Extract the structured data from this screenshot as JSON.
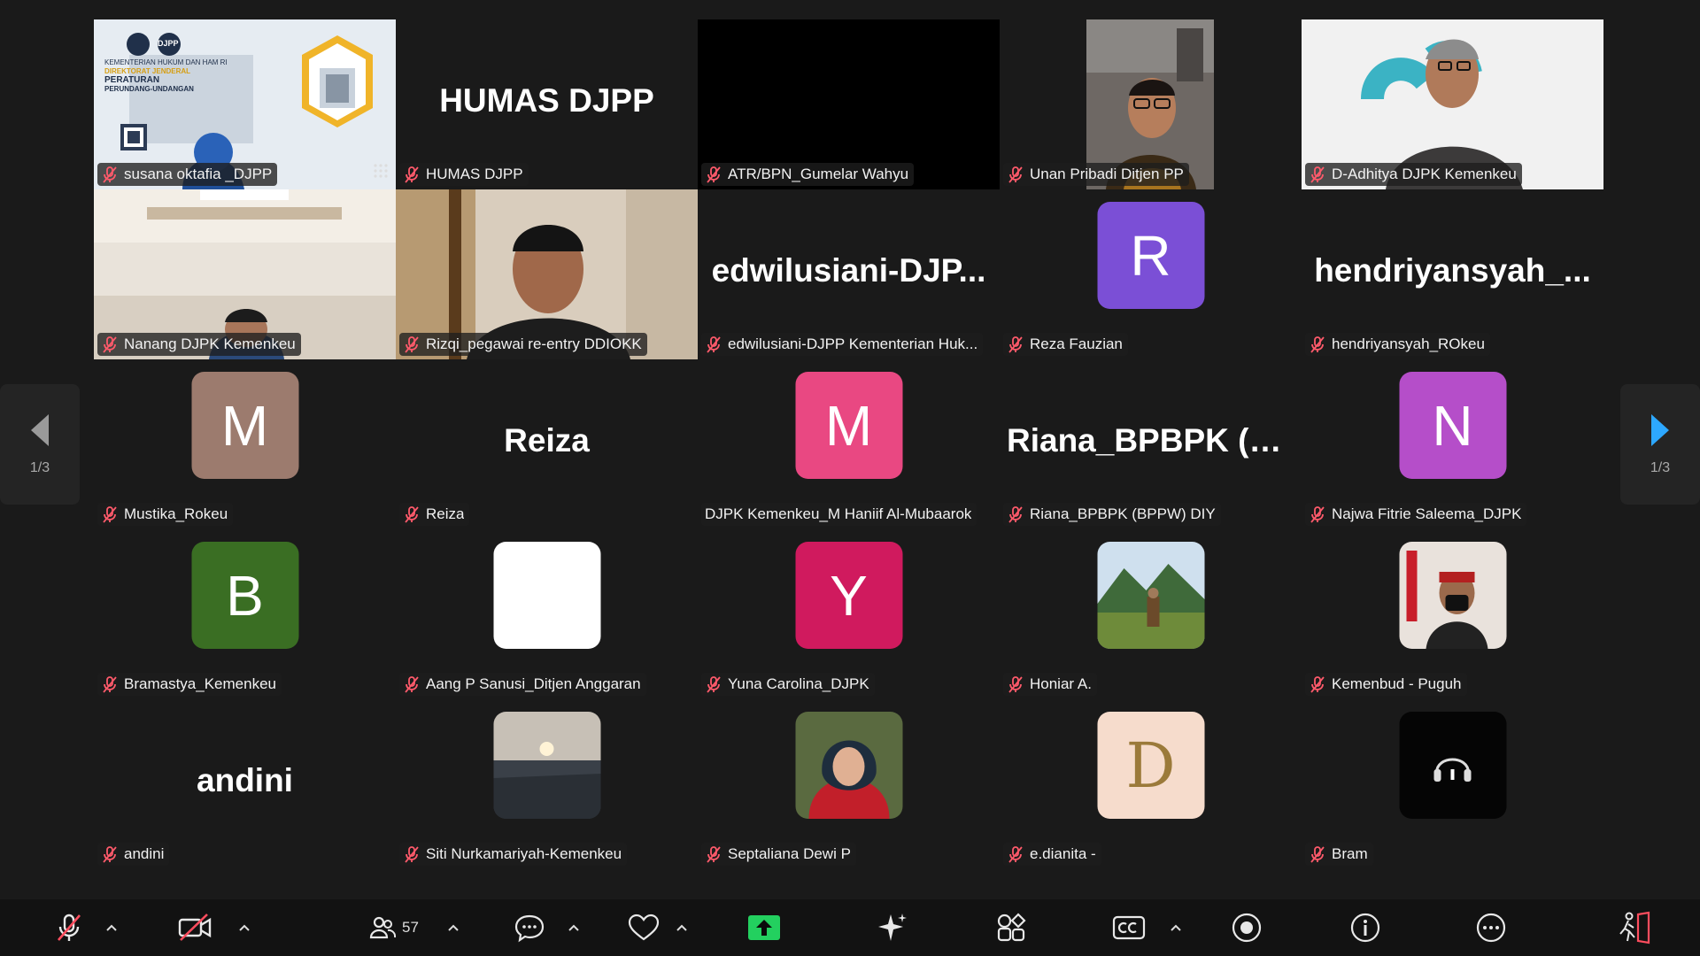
{
  "pagination": {
    "left": "1/3",
    "right": "1/3"
  },
  "presentation": {
    "line1": "KEMENTERIAN HUKUM DAN HAM RI",
    "line2": "DIREKTORAT JENDERAL",
    "line3": "PERATURAN",
    "line4": "PERUNDANG-UNDANGAN",
    "badge": "DJPP"
  },
  "tiles": [
    {
      "name": "susana oktafia _DJPP",
      "type": "share"
    },
    {
      "name": "HUMAS DJPP",
      "type": "bigname",
      "big": "HUMAS DJPP"
    },
    {
      "name": "ATR/BPN_Gumelar Wahyu",
      "type": "black"
    },
    {
      "name": "Unan Pribadi Ditjen PP",
      "type": "video1"
    },
    {
      "name": "D-Adhitya DJPK Kemenkeu",
      "type": "video2"
    },
    {
      "name": "Nanang DJPK Kemenkeu",
      "type": "video3"
    },
    {
      "name": "Rizqi_pegawai re-entry DDIOKK",
      "type": "video4"
    },
    {
      "name": "edwilusiani-DJPP Kementerian Huk...",
      "type": "bigname",
      "big": "edwilusiani-DJP..."
    },
    {
      "name": "Reza Fauzian",
      "type": "avatar",
      "letter": "R",
      "color": "#7b4fd6"
    },
    {
      "name": "hendriyansyah_ROkeu",
      "type": "bigname",
      "big": "hendriyansyah_..."
    },
    {
      "name": "Mustika_Rokeu",
      "type": "avatar",
      "letter": "M",
      "color": "#9c7b6e"
    },
    {
      "name": "Reiza",
      "type": "bigname",
      "big": "Reiza"
    },
    {
      "name": "DJPK Kemenkeu_M Haniif Al-Mubaarok",
      "type": "avatar",
      "letter": "M",
      "color": "#e94882",
      "nomic": true
    },
    {
      "name": "Riana_BPBPK (BPPW) DIY",
      "type": "bigname",
      "big": "Riana_BPBPK  (B..."
    },
    {
      "name": "Najwa Fitrie Saleema_DJPK",
      "type": "avatar",
      "letter": "N",
      "color": "#b54ec9"
    },
    {
      "name": "Bramastya_Kemenkeu",
      "type": "avatar",
      "letter": "B",
      "color": "#3a6e23"
    },
    {
      "name": "Aang P Sanusi_Ditjen Anggaran",
      "type": "avatar",
      "letter": "",
      "color": "#ffffff"
    },
    {
      "name": "Yuna Carolina_DJPK",
      "type": "avatar",
      "letter": "Y",
      "color": "#d01a5e"
    },
    {
      "name": "Honiar A.",
      "type": "photo-landscape"
    },
    {
      "name": "Kemenbud - Puguh",
      "type": "photo-person"
    },
    {
      "name": "andini",
      "type": "bigname",
      "big": "andini"
    },
    {
      "name": "Siti Nurkamariyah-Kemenkeu",
      "type": "photo-sunset"
    },
    {
      "name": "Septaliana Dewi P",
      "type": "photo-hijab"
    },
    {
      "name": "e.dianita -",
      "type": "avatar-d",
      "letter": "D",
      "color": "#f6dccc"
    },
    {
      "name": "Bram",
      "type": "avatar-headphones",
      "color": "#050505"
    }
  ],
  "toolbar": {
    "participants_count": "57"
  },
  "colors": {
    "accent": "#23d05f",
    "muted": "#ff5a6b",
    "share": "#23d05f",
    "pager_arrow": "#2da8ff"
  }
}
